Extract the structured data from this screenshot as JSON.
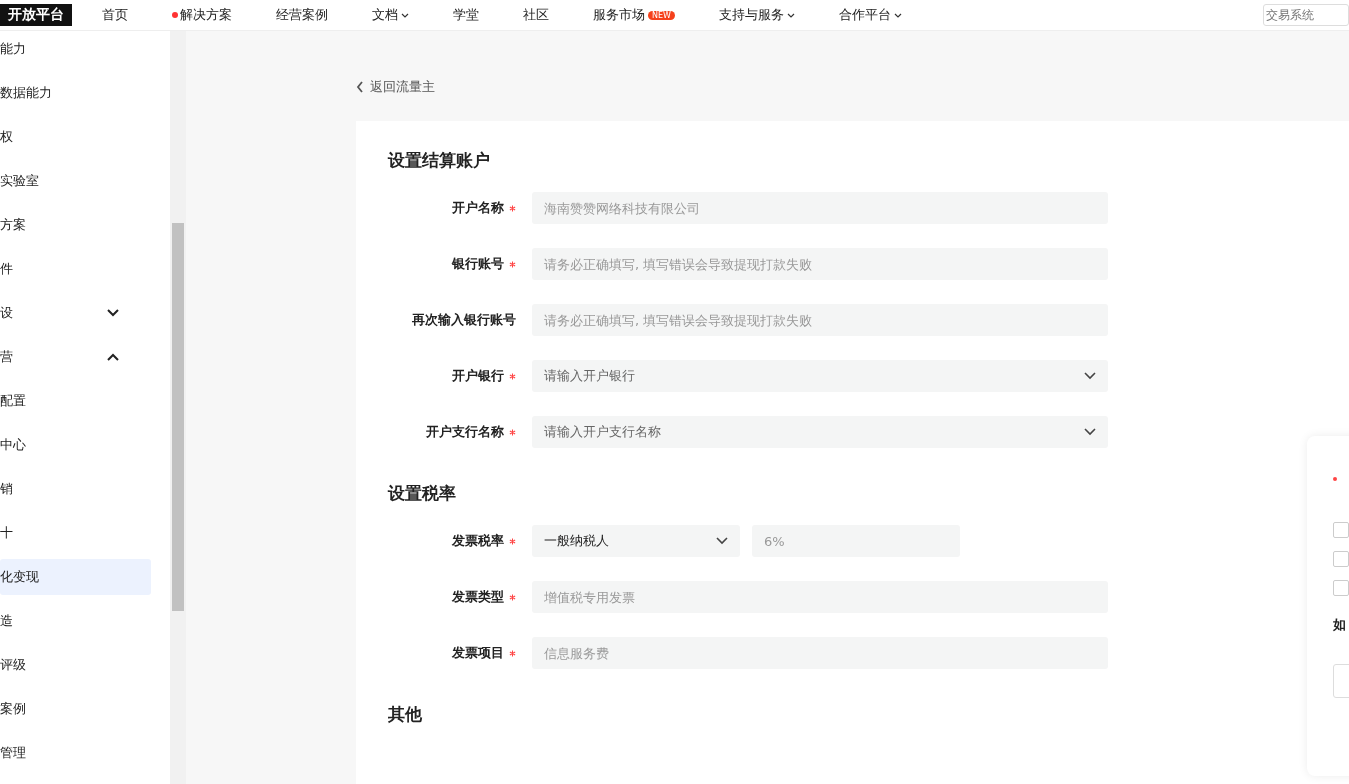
{
  "header": {
    "logo": "开放平台",
    "nav": [
      {
        "label": "首页",
        "dot": false,
        "caret": false
      },
      {
        "label": "解决方案",
        "dot": true,
        "caret": false
      },
      {
        "label": "经营案例",
        "dot": false,
        "caret": false
      },
      {
        "label": "文档",
        "dot": false,
        "caret": true
      },
      {
        "label": "学堂",
        "dot": false,
        "caret": false
      },
      {
        "label": "社区",
        "dot": false,
        "caret": false
      },
      {
        "label": "服务市场",
        "dot": false,
        "caret": false,
        "badge": "NEW"
      },
      {
        "label": "支持与服务",
        "dot": false,
        "caret": true
      },
      {
        "label": "合作平台",
        "dot": false,
        "caret": true
      }
    ],
    "search": {
      "placeholder": "交易系统"
    }
  },
  "sidebar": {
    "items": [
      {
        "label": "能力",
        "selected": false
      },
      {
        "label": "数据能力",
        "selected": false
      },
      {
        "label": "权",
        "selected": false
      },
      {
        "label": "实验室",
        "selected": false
      },
      {
        "label": "方案",
        "selected": false
      },
      {
        "label": "件",
        "selected": false
      },
      {
        "label": "设",
        "selected": false,
        "expanded": false
      },
      {
        "label": "营",
        "selected": false,
        "expanded": true
      },
      {
        "label": "配置",
        "selected": false
      },
      {
        "label": "中心",
        "selected": false
      },
      {
        "label": "销",
        "selected": false
      },
      {
        "label": "十",
        "selected": false
      },
      {
        "label": "化变现",
        "selected": true
      },
      {
        "label": "造",
        "selected": false
      },
      {
        "label": "评级",
        "selected": false
      },
      {
        "label": "案例",
        "selected": false
      },
      {
        "label": "管理",
        "selected": false
      }
    ]
  },
  "back_link": "返回流量主",
  "sections": [
    {
      "title": "设置结算账户",
      "fields": [
        {
          "label": "开户名称",
          "required": true,
          "kind": "text",
          "placeholder": "海南赞赞网络科技有限公司"
        },
        {
          "label": "银行账号",
          "required": true,
          "kind": "text",
          "placeholder": "请务必正确填写, 填写错误会导致提现打款失败"
        },
        {
          "label": "再次输入银行账号",
          "required": false,
          "kind": "text",
          "placeholder": "请务必正确填写, 填写错误会导致提现打款失败"
        },
        {
          "label": "开户银行",
          "required": true,
          "kind": "select",
          "placeholder": "请输入开户银行"
        },
        {
          "label": "开户支行名称",
          "required": true,
          "kind": "select",
          "placeholder": "请输入开户支行名称"
        }
      ]
    },
    {
      "title": "设置税率",
      "fields": [
        {
          "label": "发票税率",
          "required": true,
          "kind": "select-pair",
          "value": "一般纳税人",
          "placeholder": "6%"
        },
        {
          "label": "发票类型",
          "required": true,
          "kind": "text",
          "placeholder": "增值税专用发票"
        },
        {
          "label": "发票项目",
          "required": true,
          "kind": "text",
          "placeholder": "信息服务费"
        }
      ]
    },
    {
      "title": "其他"
    }
  ],
  "side_card": {
    "checkboxes": [
      {
        "checked": false
      },
      {
        "checked": false
      },
      {
        "checked": false
      }
    ],
    "note": "如"
  }
}
